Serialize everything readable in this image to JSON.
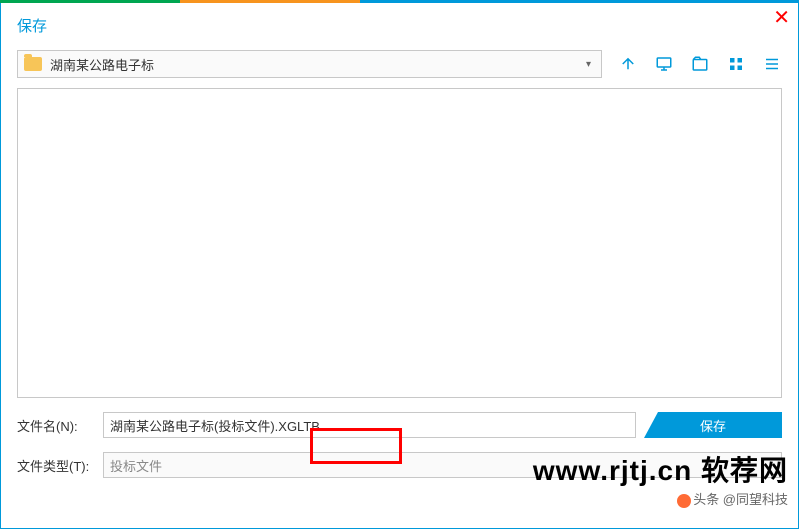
{
  "title": "保存",
  "path_combo": {
    "text": "湖南某公路电子标"
  },
  "filename": {
    "label": "文件名(N):",
    "value": "湖南某公路电子标(投标文件).XGLTB"
  },
  "filetype": {
    "label": "文件类型(T):",
    "value": "投标文件"
  },
  "buttons": {
    "save": "保存"
  },
  "watermark": {
    "main": "www.rjtj.cn 软荐网",
    "sub": "头条 @同望科技"
  }
}
